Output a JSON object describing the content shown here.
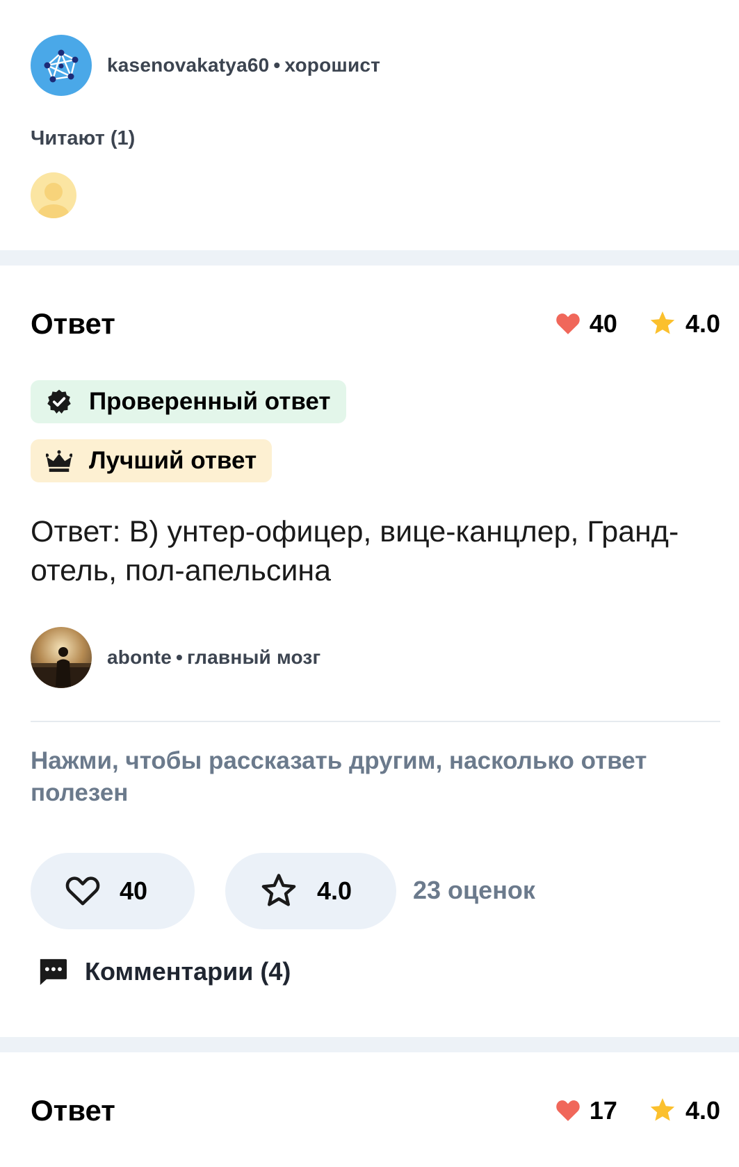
{
  "question_author": {
    "username": "kasenovakatya60",
    "separator": "•",
    "rank": "хорошист"
  },
  "readers": {
    "title": "Читают (1)"
  },
  "answer1": {
    "heading": "Ответ",
    "likes": "40",
    "rating": "4.0",
    "badges": {
      "verified": "Проверенный ответ",
      "best": "Лучший ответ"
    },
    "text": "Ответ: В) унтер-офицер, вице-канцлер, Гранд-отель, пол-апельсина",
    "author": {
      "username": "abonte",
      "separator": "•",
      "rank": "главный мозг"
    },
    "rate_hint": "Нажми, чтобы рассказать другим, насколько ответ полезен",
    "like_button_value": "40",
    "rate_button_value": "4.0",
    "ratings_count": "23 оценок",
    "comments_label": "Комментарии (4)"
  },
  "answer2": {
    "heading": "Ответ",
    "likes": "17",
    "rating": "4.0"
  },
  "colors": {
    "heart": "#f0675a",
    "star": "#fbc02d",
    "verified_badge_bg": "#e3f6ea",
    "best_badge_bg": "#fdf0d2",
    "pill_bg": "#ebf1f8",
    "muted_text": "#6b7a8c",
    "band": "#edf2f7"
  },
  "icons": [
    "molecule-avatar-icon",
    "user-placeholder-icon",
    "heart-icon",
    "star-icon",
    "verified-check-icon",
    "crown-icon",
    "heart-outline-icon",
    "star-outline-icon",
    "comment-icon"
  ]
}
